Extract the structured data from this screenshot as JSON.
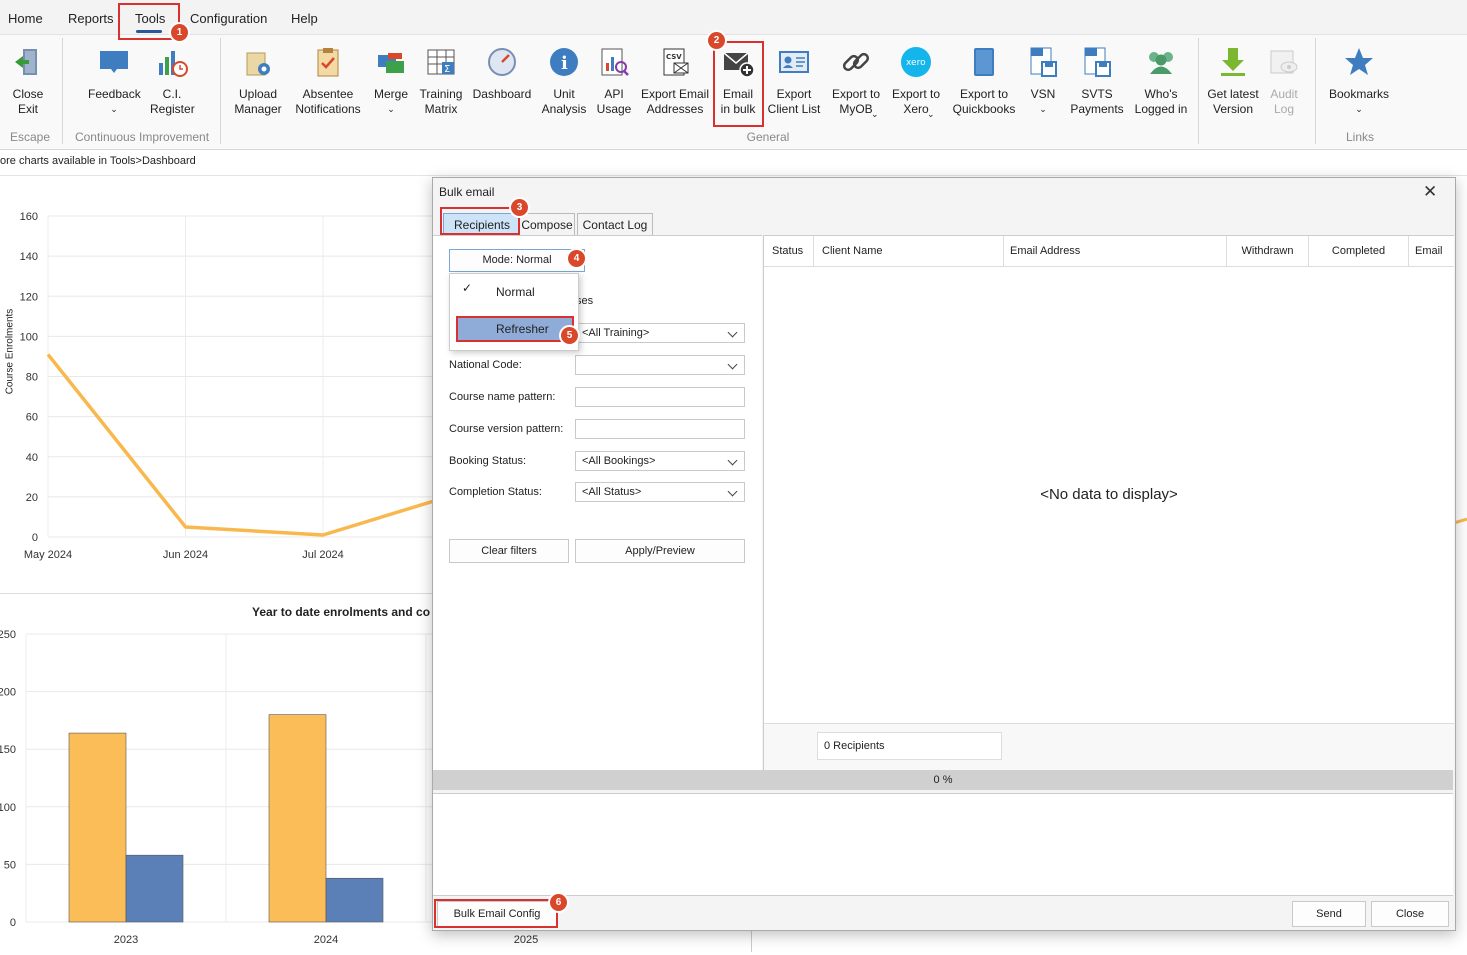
{
  "menu": {
    "items": [
      "Home",
      "Reports",
      "Tools",
      "Configuration",
      "Help"
    ]
  },
  "ribbon": {
    "groups": {
      "escape": "Escape",
      "ci": "Continuous Improvement",
      "general": "General",
      "links": "Links"
    },
    "buttons": {
      "close_exit": "Close\nExit",
      "feedback": "Feedback",
      "ci_register": "C.I.\nRegister",
      "upload_manager": "Upload\nManager",
      "absentee": "Absentee\nNotifications",
      "merge": "Merge",
      "training_matrix": "Training\nMatrix",
      "dashboard": "Dashboard",
      "unit_analysis": "Unit\nAnalysis",
      "api_usage": "API\nUsage",
      "export_email": "Export Email\nAddresses",
      "email_bulk": "Email\nin bulk",
      "export_client": "Export\nClient List",
      "export_myob": "Export to\nMyOB",
      "export_xero": "Export to\nXero",
      "export_qb": "Export to\nQuickbooks",
      "vsn": "VSN",
      "svts": "SVTS\nPayments",
      "whos_logged": "Who's\nLogged in",
      "get_latest": "Get latest\nVersion",
      "audit_log": "Audit\nLog",
      "bookmarks": "Bookmarks"
    },
    "xero_text": "xero",
    "csv_text": "CSV"
  },
  "hint": "ore charts available in Tools>Dashboard",
  "line_chart": {
    "ylabel": "Course Enrolments",
    "yticks": [
      "160",
      "140",
      "120",
      "100",
      "80",
      "60",
      "40",
      "20",
      "0"
    ],
    "xticks": [
      "May 2024",
      "Jun 2024",
      "Jul 2024"
    ],
    "color": "#f9b84d"
  },
  "bar_chart": {
    "title": "Year to date enrolments and co",
    "yticks": [
      "250",
      "200",
      "150",
      "100",
      "50",
      "0"
    ],
    "xticks": [
      "2023",
      "2024",
      "2025"
    ],
    "colors": [
      "#fbbd57",
      "#5b7fb7"
    ]
  },
  "chart_data": [
    {
      "type": "line",
      "ylabel": "Course Enrolments",
      "ylim": [
        0,
        160
      ],
      "x": [
        "May 2024",
        "Jun 2024",
        "Jul 2024"
      ],
      "series": [
        {
          "values": [
            91,
            5,
            1
          ]
        }
      ]
    },
    {
      "type": "bar",
      "title": "Year to date enrolments and co",
      "ylim": [
        0,
        250
      ],
      "categories": [
        "2023",
        "2024",
        "2025"
      ],
      "series": [
        {
          "values": [
            164,
            180,
            null
          ]
        },
        {
          "values": [
            58,
            38,
            null
          ]
        }
      ]
    }
  ],
  "dialog": {
    "title": "Bulk email",
    "tabs": [
      "Recipients",
      "Compose",
      "Contact Log"
    ],
    "mode_button": "Mode: Normal",
    "mode_options": [
      "Normal",
      "Refresher"
    ],
    "hidden_partial": "ses",
    "filters": {
      "training_value": "<All Training>",
      "national_code_label": "National Code:",
      "course_name_label": "Course name pattern:",
      "course_version_label": "Course version pattern:",
      "booking_label": "Booking Status:",
      "booking_value": "<All Bookings>",
      "completion_label": "Completion Status:",
      "completion_value": "<All Status>"
    },
    "clear_filters": "Clear filters",
    "apply_preview": "Apply/Preview",
    "columns": [
      "Status",
      "Client Name",
      "Email Address",
      "Withdrawn",
      "Completed",
      "Email"
    ],
    "no_data": "<No data to display>",
    "recipients_count": "0 Recipients",
    "progress_text": "0 %",
    "progress": 0,
    "bulk_config": "Bulk Email Config",
    "send": "Send",
    "close": "Close"
  },
  "badges": [
    "1",
    "2",
    "3",
    "4",
    "5",
    "6"
  ]
}
